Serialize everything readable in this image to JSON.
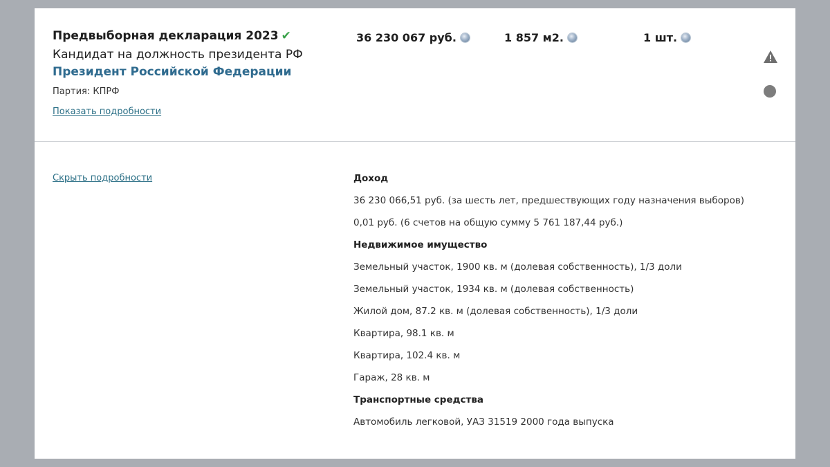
{
  "declaration": {
    "title": "Предвыборная декларация 2023",
    "check_icon": "checkmark-icon",
    "role": "Кандидат на должность президента РФ",
    "position": "Президент Российской Федерации",
    "party": "Партия: КПРФ",
    "show_details": "Показать подробности",
    "hide_details": "Скрыть подробности"
  },
  "stats": {
    "income": "36 230 067 руб.",
    "area": "1 857 м2.",
    "count": "1 шт."
  },
  "indicators": {
    "warning_icon": "warning-icon",
    "status_dot_color": "#7d7d7d"
  },
  "details": {
    "income": {
      "title": "Доход",
      "items": [
        "36 230 066,51 руб. (за шесть лет, предшествующих году назначения выборов)",
        "0,01 руб. (6 счетов на общую сумму 5 761 187,44 руб.)"
      ]
    },
    "real_estate": {
      "title": "Недвижимое имущество",
      "items": [
        "Земельный участок, 1900 кв. м (долевая собственность), 1/3 доли",
        "Земельный участок, 1934 кв. м (долевая собственность)",
        "Жилой дом, 87.2 кв. м (долевая собственность), 1/3 доли",
        "Квартира, 98.1 кв. м",
        "Квартира, 102.4 кв. м",
        "Гараж, 28 кв. м"
      ]
    },
    "vehicles": {
      "title": "Транспортные средства",
      "items": [
        "Автомобиль легковой, УАЗ 31519 2000 года выпуска"
      ]
    }
  },
  "colors": {
    "background": "#a9adb3",
    "card": "#ffffff",
    "position_link": "#2f6b8f",
    "link": "#2b6f86",
    "check": "#3aa24a"
  }
}
